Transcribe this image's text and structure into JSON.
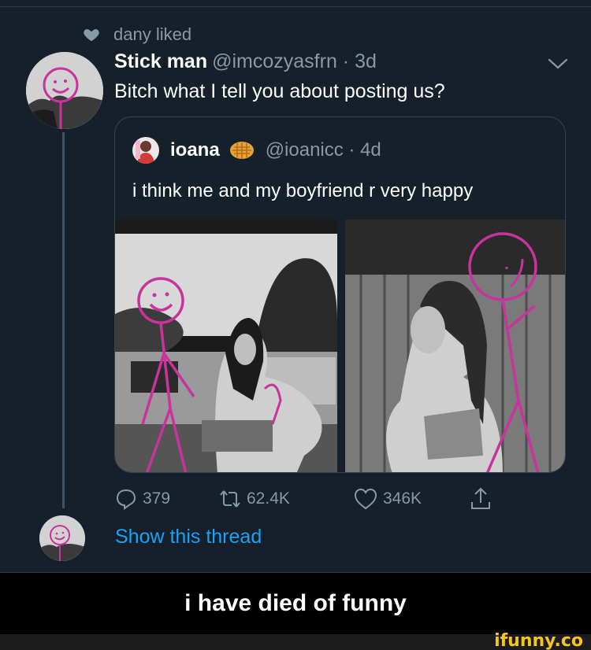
{
  "liked": {
    "text": "dany liked",
    "icon": "heart-icon"
  },
  "tweet": {
    "name": "Stick man",
    "handle": "@imcozyasfrn · 3d",
    "text": "Bitch what I tell you about posting us?"
  },
  "quote": {
    "name": "ioana",
    "handle": "@ioanicc · 4d",
    "text": "i think me and my boyfriend r very happy",
    "emoji": "waffle-icon"
  },
  "actions": {
    "replies": "379",
    "retweets": "62.4K",
    "likes": "346K"
  },
  "show_thread": "Show this thread",
  "caption": "i have died of funny",
  "watermark": "ifunny.co",
  "colors": {
    "background": "#15202b",
    "accent": "#1da1f2",
    "muted": "#8899a6",
    "doodle": "#c8339c"
  }
}
